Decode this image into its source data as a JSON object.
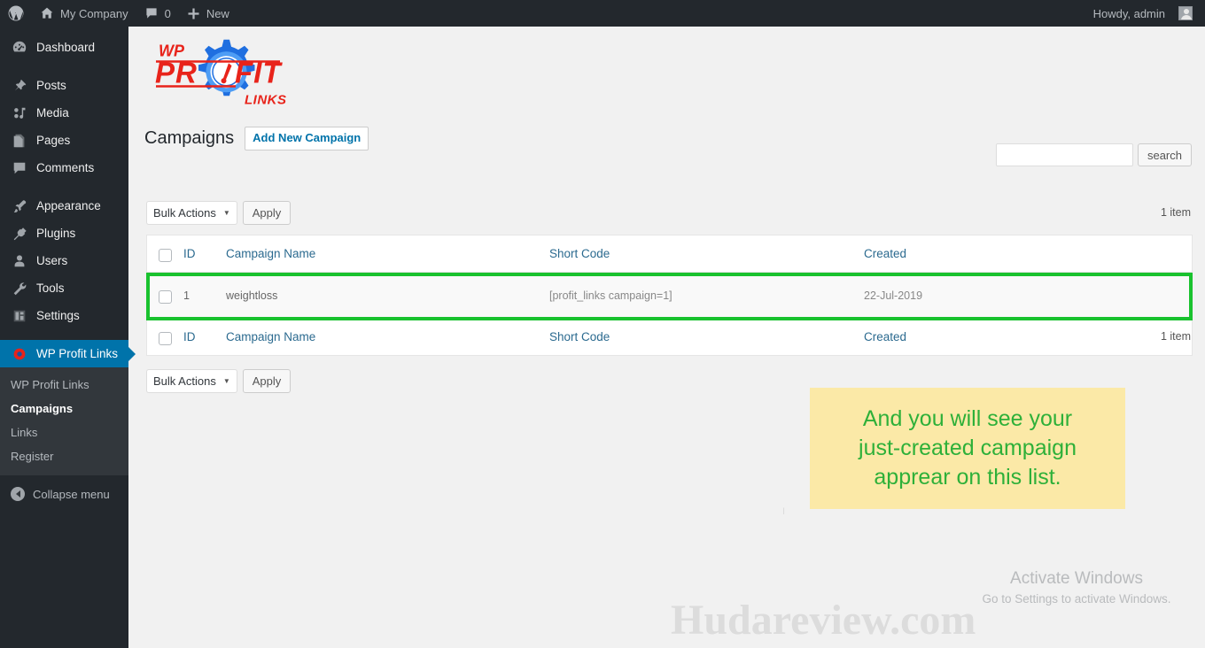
{
  "adminbar": {
    "wp_logo_icon": "wordpress-icon",
    "site_name": "My Company",
    "site_icon": "home-icon",
    "comments_icon": "comment-bubble-icon",
    "comments_count": "0",
    "new_icon": "plus-icon",
    "new_label": "New",
    "howdy": "Howdy, admin",
    "avatar_icon": "avatar-icon"
  },
  "sidebar": {
    "items": [
      {
        "label": "Dashboard",
        "icon": "dashboard-icon",
        "current": false
      },
      {
        "label": "Posts",
        "icon": "pin-icon",
        "current": false
      },
      {
        "label": "Media",
        "icon": "media-icon",
        "current": false
      },
      {
        "label": "Pages",
        "icon": "page-icon",
        "current": false
      },
      {
        "label": "Comments",
        "icon": "comment-icon",
        "current": false
      },
      {
        "label": "Appearance",
        "icon": "brush-icon",
        "current": false
      },
      {
        "label": "Plugins",
        "icon": "plug-icon",
        "current": false
      },
      {
        "label": "Users",
        "icon": "user-icon",
        "current": false
      },
      {
        "label": "Tools",
        "icon": "wrench-icon",
        "current": false
      },
      {
        "label": "Settings",
        "icon": "settings-icon",
        "current": false
      },
      {
        "label": "WP Profit Links",
        "icon": "profit-links-icon",
        "current": true
      }
    ],
    "submenu": [
      {
        "label": "WP Profit Links",
        "active": false
      },
      {
        "label": "Campaigns",
        "active": true
      },
      {
        "label": "Links",
        "active": false
      },
      {
        "label": "Register",
        "active": false
      }
    ],
    "collapse_label": "Collapse menu",
    "collapse_icon": "collapse-arrow-icon"
  },
  "logo": {
    "name": "wp-profit-links-logo",
    "text_wp": "WP",
    "text_profit": "PROFIT",
    "text_links": "LINKS",
    "gear_color": "#1f6fe0",
    "text_color": "#e8231a"
  },
  "page": {
    "title": "Campaigns",
    "add_new_label": "Add New Campaign"
  },
  "search": {
    "value": "",
    "placeholder": "",
    "button_label": "search"
  },
  "toolbar": {
    "bulk_actions_label": "Bulk Actions",
    "apply_label": "Apply",
    "caret_icon": "chevron-down-icon",
    "item_count_top": "1 item",
    "item_count_bottom": "1 item"
  },
  "table": {
    "columns": [
      "ID",
      "Campaign Name",
      "Short Code",
      "Created"
    ],
    "rows": [
      {
        "id": "1",
        "name": "weightloss",
        "code": "[profit_links campaign=1]",
        "created": "22-Jul-2019"
      }
    ],
    "highlight_color": "#19c22e"
  },
  "callout": {
    "line1": "And you will see your",
    "line2": "just-created campaign",
    "line3": "apprear on this list.",
    "bg_color": "#fbe9a7",
    "text_color": "#2eb039"
  },
  "activate_windows": {
    "title": "Activate Windows",
    "subtitle": "Go to Settings to activate Windows."
  },
  "watermark": {
    "text": "Hudareview.com"
  },
  "cursor": {
    "glyph": "I"
  }
}
